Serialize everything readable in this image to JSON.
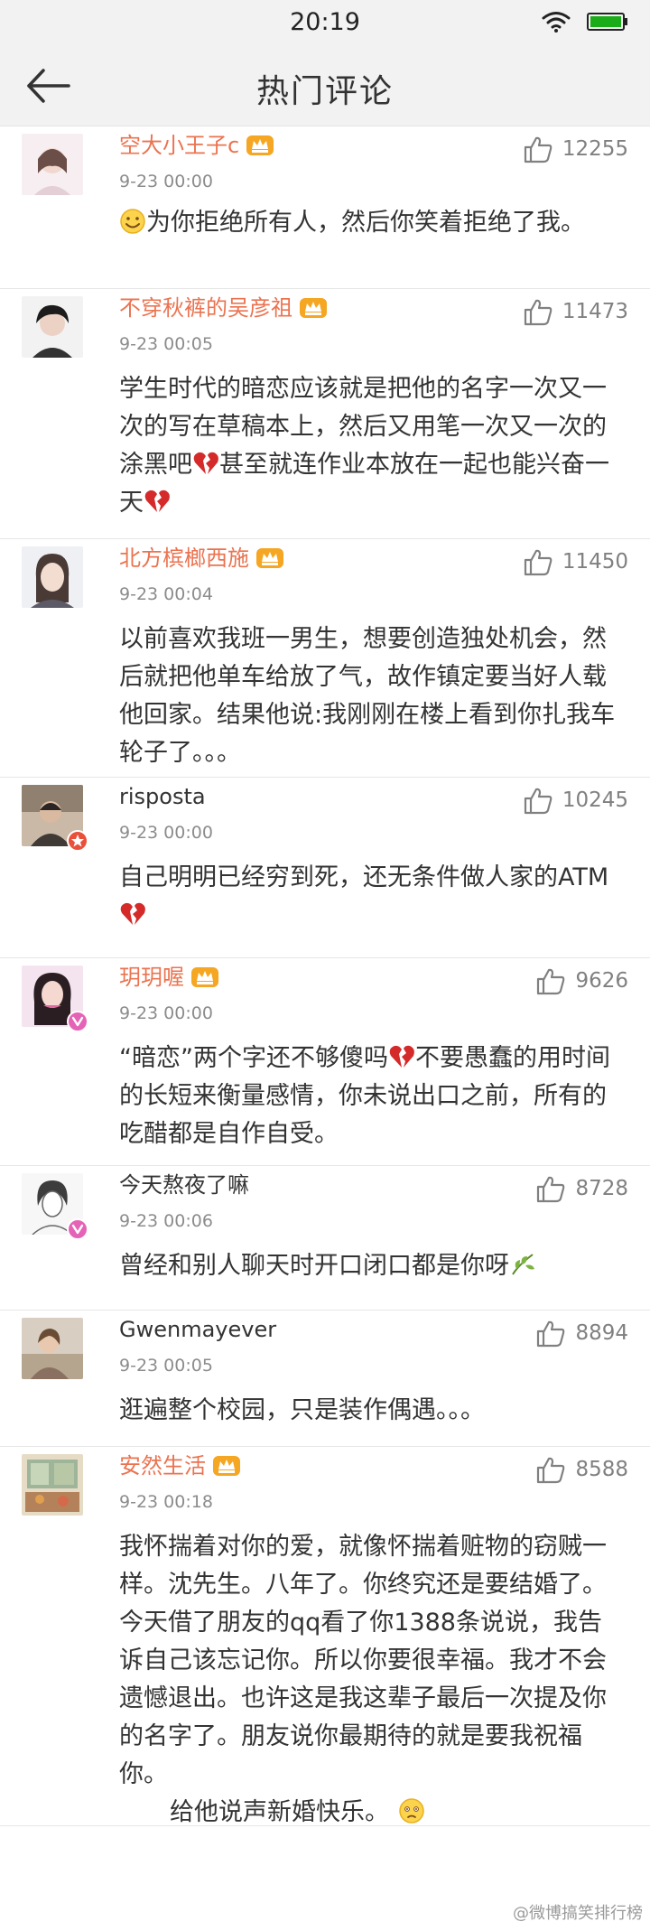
{
  "status_bar": {
    "time": "20:19"
  },
  "nav": {
    "title": "热门评论"
  },
  "comments": [
    {
      "username": "空大小王子c",
      "time": "9-23 00:00",
      "likes": "12255",
      "text": "为你拒绝所有人，然后你笑着拒绝了我。"
    },
    {
      "username": "不穿秋裤的吴彦祖",
      "time": "9-23 00:05",
      "likes": "11473",
      "text_a": "学生时代的暗恋应该就是把他的名字一次又一次的写在草稿本上，然后又用笔一次又一次的涂黑吧",
      "text_b": "甚至就连作业本放在一起也能兴奋一天"
    },
    {
      "username": "北方槟榔西施",
      "time": "9-23 00:04",
      "likes": "11450",
      "text": "以前喜欢我班一男生，想要创造独处机会，然后就把他单车给放了气，故作镇定要当好人载他回家。结果他说:我刚刚在楼上看到你扎我车轮子了。。。"
    },
    {
      "username": "risposta",
      "time": "9-23 00:00",
      "likes": "10245",
      "text": "自己明明已经穷到死，还无条件做人家的ATM"
    },
    {
      "username": "玥玥喔",
      "time": "9-23 00:00",
      "likes": "9626",
      "text_a": "“暗恋”两个字还不够傻吗",
      "text_b": "不要愚蠢的用时间的长短来衡量感情，你未说出口之前，所有的吃醋都是自作自受。"
    },
    {
      "username": "今天熬夜了嘛",
      "time": "9-23 00:06",
      "likes": "8728",
      "text": "曾经和别人聊天时开口闭口都是你呀"
    },
    {
      "username": "Gwenmayever",
      "time": "9-23 00:05",
      "likes": "8894",
      "text": "逛遍整个校园，只是装作偶遇。。。"
    },
    {
      "username": "安然生活",
      "time": "9-23 00:18",
      "likes": "8588",
      "text": "我怀揣着对你的爱，就像怀揣着赃物的窃贼一样。沈先生。八年了。你终究还是要结婚了。今天借了朋友的qq看了你1388条说说，我告诉自己该忘记你。所以你要很幸福。我才不会遗憾退出。也许这是我这辈子最后一次提及你的名字了。朋友说你最期待的就是要我祝福你。",
      "text_b": "给他说声新婚快乐。"
    }
  ],
  "watermark": "@微博搞笑排行榜",
  "colors": {
    "vip_name": "#eb7350",
    "like_count": "#808080",
    "badge_red": "#e8503a",
    "badge_pink": "#e563b6",
    "crown": "#f5a623"
  },
  "icons": [
    "wifi-icon",
    "battery-icon",
    "back-arrow-icon",
    "thumb-up-icon",
    "crown-icon",
    "smile-emoji",
    "broken-heart-emoji",
    "leaf-emoji",
    "sad-emoji"
  ]
}
